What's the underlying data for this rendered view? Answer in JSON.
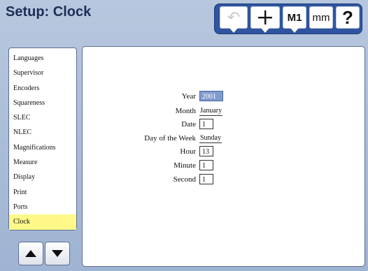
{
  "window": {
    "title": "Setup: Clock"
  },
  "toolbar": {
    "undo_icon": "↶",
    "plus_icon": "+",
    "m1_label": "M1",
    "mm_label": "mm",
    "help_label": "?"
  },
  "sidebar": {
    "items": [
      {
        "label": "Languages"
      },
      {
        "label": "Supervisor"
      },
      {
        "label": "Encoders"
      },
      {
        "label": "Squareness"
      },
      {
        "label": "SLEC"
      },
      {
        "label": "NLEC"
      },
      {
        "label": "Magnifications"
      },
      {
        "label": "Measure"
      },
      {
        "label": "Display"
      },
      {
        "label": "Print"
      },
      {
        "label": "Ports"
      },
      {
        "label": "Clock"
      }
    ],
    "selected": "Clock"
  },
  "form": {
    "year": {
      "label": "Year",
      "value": "2001"
    },
    "month": {
      "label": "Month",
      "value": "January"
    },
    "date": {
      "label": "Date",
      "value": "1"
    },
    "day_of_week": {
      "label": "Day of the Week",
      "value": "Sunday"
    },
    "hour": {
      "label": "Hour",
      "value": "13"
    },
    "minute": {
      "label": "Minute",
      "value": "1"
    },
    "second": {
      "label": "Second",
      "value": "1"
    }
  },
  "colors": {
    "toolbar_bg": "#2f55a0",
    "selected_item": "#fff98a",
    "active_field": "#7f9bd0"
  }
}
